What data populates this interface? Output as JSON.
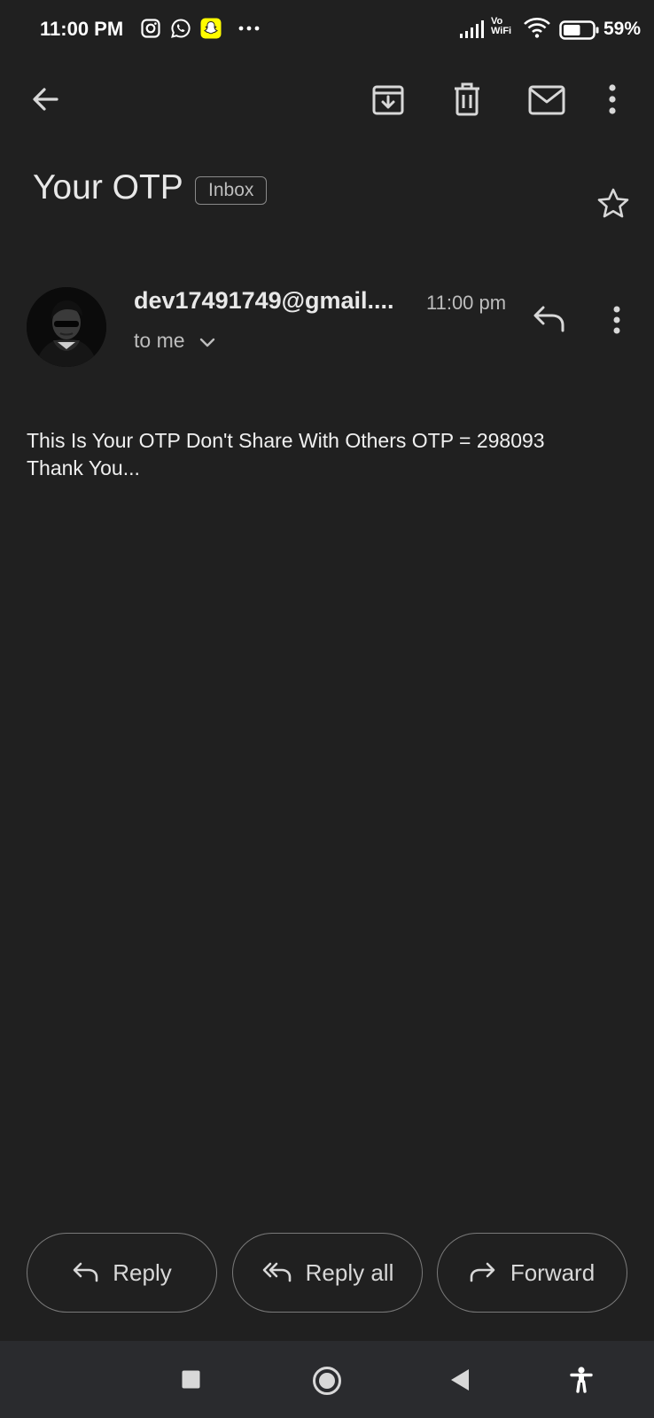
{
  "status_bar": {
    "time": "11:00 PM",
    "network_label": "Vo WiFi",
    "battery_percent": "59%",
    "notification_icons": [
      "instagram-icon",
      "whatsapp-icon",
      "snapchat-icon",
      "more-notifications-icon"
    ],
    "system_icons": [
      "signal-icon",
      "wifi-icon",
      "battery-icon"
    ],
    "battery_level": 0.59
  },
  "toolbar": {
    "icons": [
      "back-arrow-icon",
      "archive-icon",
      "delete-icon",
      "mark-unread-icon",
      "more-options-icon"
    ]
  },
  "email": {
    "subject": "Your OTP",
    "label": "Inbox",
    "sender": "dev17491749@gmail....",
    "time": "11:00 pm",
    "recipient": "to me",
    "body_line1": "This Is Your OTP Don't Share With Others OTP = 298093",
    "body_line2": "Thank You..."
  },
  "actions": {
    "reply": "Reply",
    "reply_all": "Reply all",
    "forward": "Forward"
  },
  "nav_bar": {
    "icons": [
      "recents-square-icon",
      "home-circle-icon",
      "back-triangle-icon",
      "accessibility-icon"
    ]
  },
  "colors": {
    "background": "#202020",
    "snapchat": "#FFFC00",
    "nav_bar": "#2a2b2e"
  }
}
